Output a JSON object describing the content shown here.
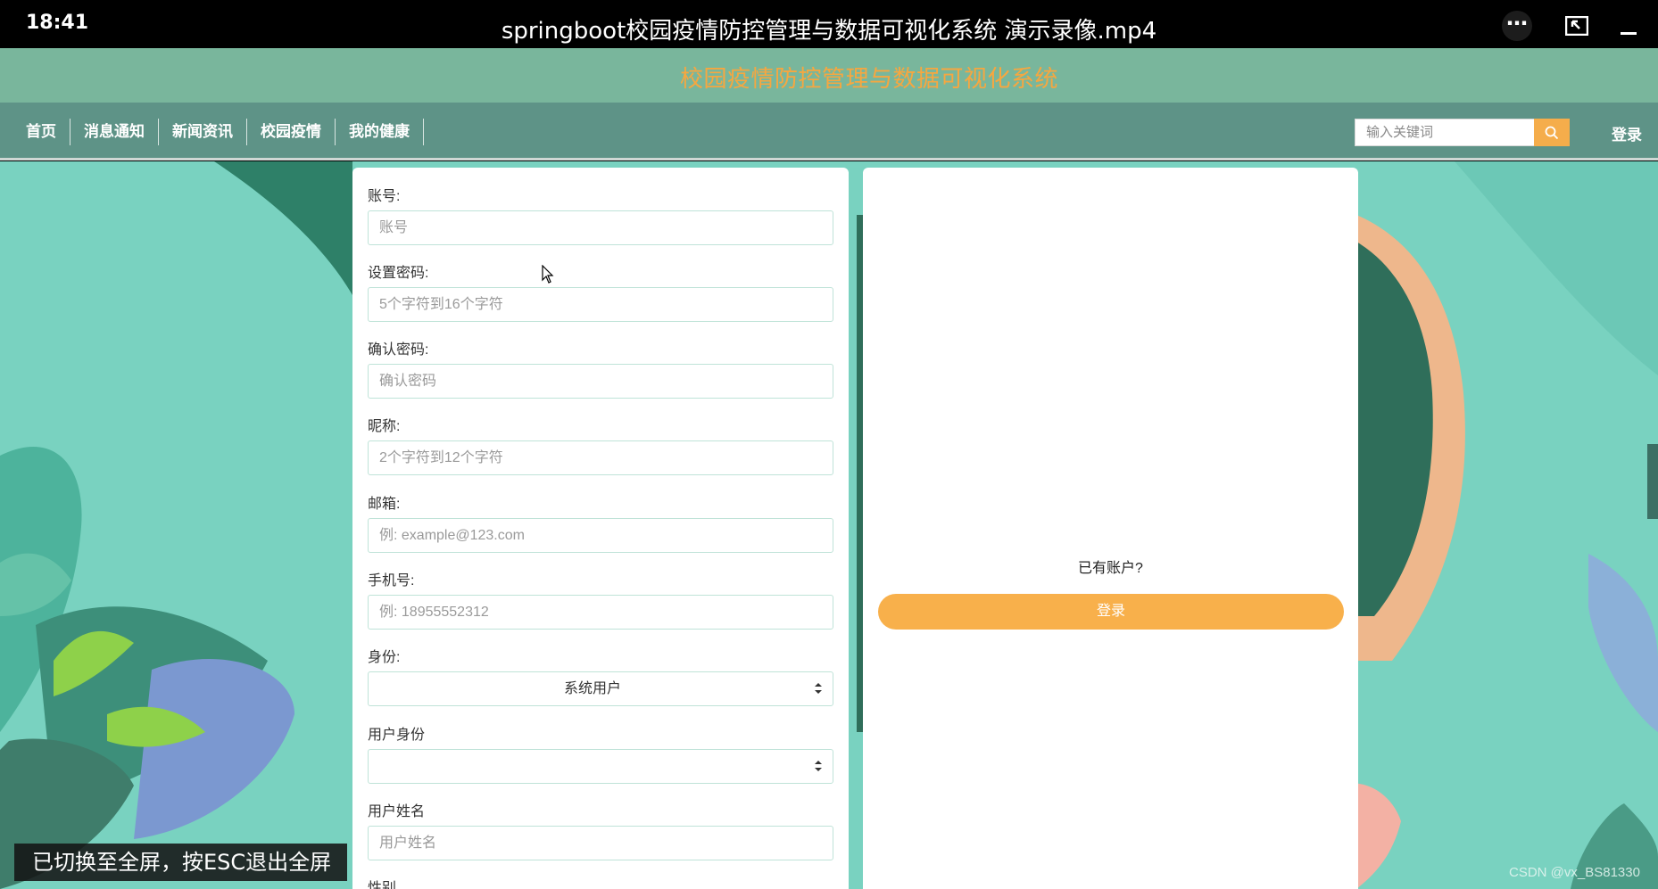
{
  "player": {
    "time": "18:41",
    "title": "springboot校园疫情防控管理与数据可视化系统 演示录像.mp4",
    "more_icon": "more-icon",
    "exit_fullscreen_icon": "exit-fullscreen-icon",
    "minimize_icon": "minimize-icon"
  },
  "site": {
    "title": "校园疫情防控管理与数据可视化系统"
  },
  "nav": {
    "items": [
      {
        "label": "首页"
      },
      {
        "label": "消息通知"
      },
      {
        "label": "新闻资讯"
      },
      {
        "label": "校园疫情"
      },
      {
        "label": "我的健康"
      }
    ],
    "search_placeholder": "输入关键词",
    "login_label": "登录"
  },
  "form": {
    "fields": [
      {
        "label": "账号:",
        "placeholder": "账号"
      },
      {
        "label": "设置密码:",
        "placeholder": "5个字符到16个字符"
      },
      {
        "label": "确认密码:",
        "placeholder": "确认密码"
      },
      {
        "label": "昵称:",
        "placeholder": "2个字符到12个字符"
      },
      {
        "label": "邮箱:",
        "placeholder": "例: example@123.com"
      },
      {
        "label": "手机号:",
        "placeholder": "例: 18955552312"
      },
      {
        "label": "身份:",
        "value": "系统用户"
      },
      {
        "label": "用户身份",
        "value": ""
      },
      {
        "label": "用户姓名",
        "placeholder": "用户姓名"
      },
      {
        "label": "性别"
      }
    ]
  },
  "right": {
    "have_account": "已有账户?",
    "login_button": "登录"
  },
  "toast": "已切换至全屏，按ESC退出全屏",
  "watermark": "CSDN @vx_BS81330",
  "colors": {
    "header_bg": "#79b69c",
    "nav_bg": "#5e9387",
    "title_color": "#f6a740",
    "accent": "#f8b04b",
    "background": "#79d2c0"
  }
}
